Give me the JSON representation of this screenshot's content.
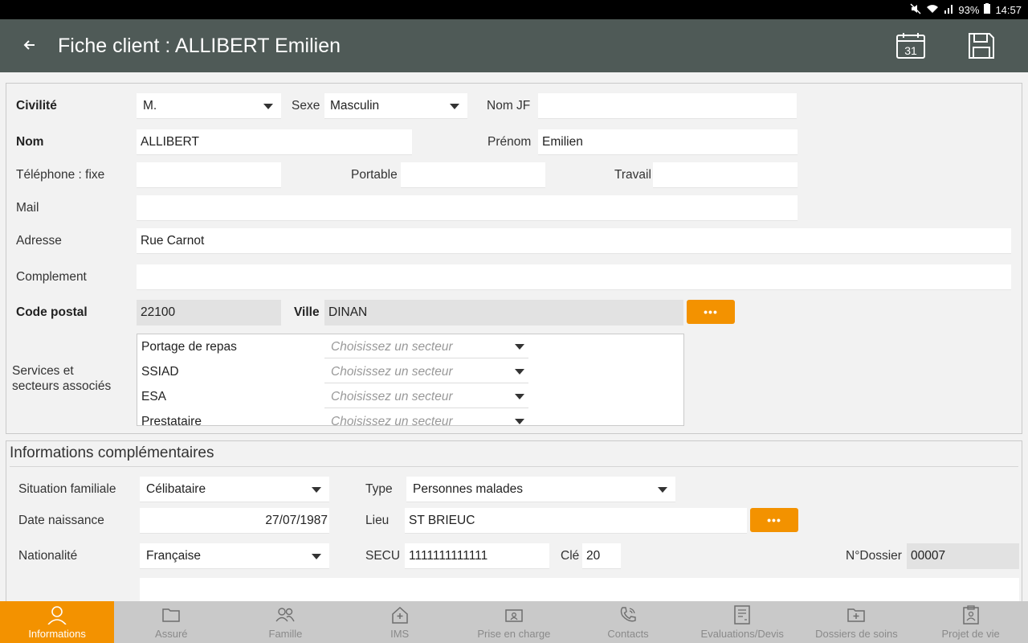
{
  "status": {
    "battery": "93%",
    "time": "14:57"
  },
  "header": {
    "title": "Fiche client : ALLIBERT Emilien",
    "back_icon": "arrow-left-icon"
  },
  "identity": {
    "civilite_label": "Civilité",
    "civilite_value": "M.",
    "sexe_label": "Sexe",
    "sexe_value": "Masculin",
    "nomjf_label": "Nom JF",
    "nomjf_value": "",
    "nom_label": "Nom",
    "nom_value": "ALLIBERT",
    "prenom_label": "Prénom",
    "prenom_value": "Emilien",
    "tel_label": "Téléphone : fixe",
    "tel_value": "",
    "portable_label": "Portable",
    "portable_value": "",
    "travail_label": "Travail",
    "travail_value": "",
    "mail_label": "Mail",
    "mail_value": "",
    "adresse_label": "Adresse",
    "adresse_value": "Rue Carnot",
    "complement_label": "Complement",
    "complement_value": "",
    "cp_label": "Code postal",
    "cp_value": "22100",
    "ville_label": "Ville",
    "ville_value": "DINAN",
    "more_label": "•••"
  },
  "services": {
    "label_line1": "Services et",
    "label_line2": "secteurs associés",
    "placeholder": "Choisissez un secteur",
    "items": [
      {
        "name": "Portage de repas"
      },
      {
        "name": "SSIAD"
      },
      {
        "name": "ESA"
      },
      {
        "name": "Prestataire"
      }
    ]
  },
  "complementary": {
    "title": "Informations complémentaires",
    "situation_label": "Situation familiale",
    "situation_value": "Célibataire",
    "type_label": "Type",
    "type_value": "Personnes malades",
    "naissance_label": "Date naissance",
    "naissance_value": "27/07/1987",
    "lieu_label": "Lieu",
    "lieu_value": "ST BRIEUC",
    "nationalite_label": "Nationalité",
    "nationalite_value": "Française",
    "secu_label": "SECU",
    "secu_value": "1111111111111",
    "cle_label": "Clé",
    "cle_value": "20",
    "dossier_label": "N°Dossier",
    "dossier_value": "00007",
    "more_label": "•••"
  },
  "nav": {
    "tabs": [
      {
        "label": "Informations",
        "icon": "person-icon",
        "active": true
      },
      {
        "label": "Assuré",
        "icon": "folder-icon"
      },
      {
        "label": "Famille",
        "icon": "people-icon"
      },
      {
        "label": "IMS",
        "icon": "house-plus-icon"
      },
      {
        "label": "Prise en charge",
        "icon": "case-person-icon"
      },
      {
        "label": "Contacts",
        "icon": "phone-icon"
      },
      {
        "label": "Evaluations/Devis",
        "icon": "document-icon"
      },
      {
        "label": "Dossiers de soins",
        "icon": "medical-folder-icon"
      },
      {
        "label": "Projet de vie",
        "icon": "clipboard-person-icon"
      }
    ]
  },
  "colors": {
    "accent": "#f39200",
    "appbar": "#4f5a57"
  }
}
